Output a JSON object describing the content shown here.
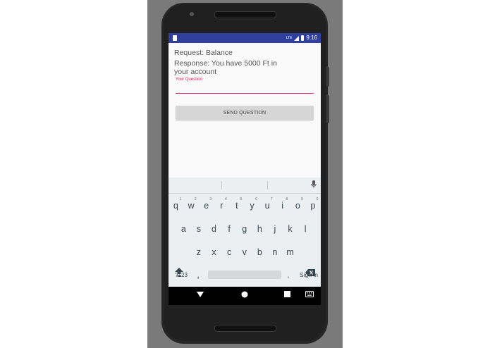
{
  "status_bar": {
    "time": "9:16",
    "network": "LTE"
  },
  "app": {
    "request_text": "Request: Balance",
    "response_line1": "Response: You have 5000 Ft in",
    "response_line2": "your account",
    "question_hint": "Your Question",
    "question_value": "",
    "send_button": "SEND QUESTION"
  },
  "keyboard": {
    "row1": [
      "q",
      "w",
      "e",
      "r",
      "t",
      "y",
      "u",
      "i",
      "o",
      "p"
    ],
    "row1_hints": [
      "1",
      "2",
      "3",
      "4",
      "5",
      "6",
      "7",
      "8",
      "9",
      "0"
    ],
    "row2": [
      "a",
      "s",
      "d",
      "f",
      "g",
      "h",
      "j",
      "k",
      "l"
    ],
    "row3": [
      "z",
      "x",
      "c",
      "v",
      "b",
      "n",
      "m"
    ],
    "symbols_key": "?123",
    "comma_key": ",",
    "period_key": ".",
    "action_key": "Sign in"
  },
  "icons": {
    "shift": "shift-icon",
    "backspace": "backspace-icon",
    "mic": "mic-icon",
    "back": "nav-back-icon",
    "home": "nav-home-icon",
    "recents": "nav-recents-icon",
    "keyboard": "keyboard-switch-icon"
  },
  "colors": {
    "status_bar": "#303f9f",
    "accent": "#e91e63"
  }
}
